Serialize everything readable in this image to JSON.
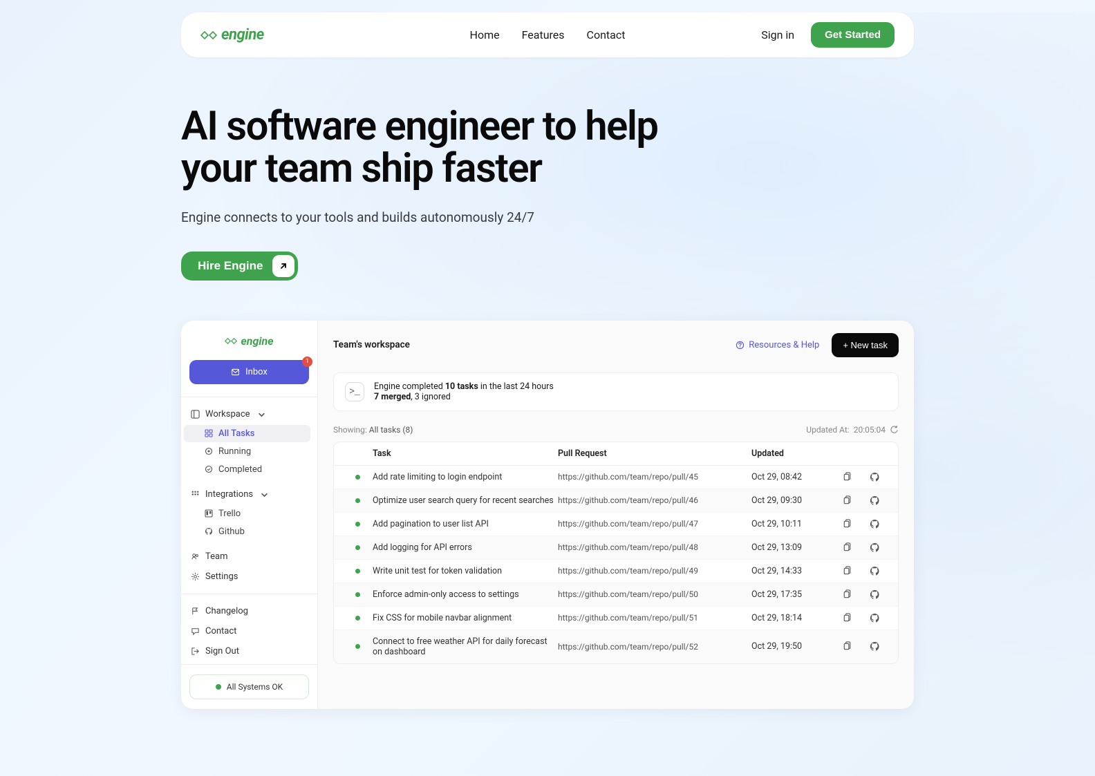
{
  "nav": {
    "brand": "engine",
    "links": [
      "Home",
      "Features",
      "Contact"
    ],
    "signin": "Sign in",
    "cta": "Get Started"
  },
  "hero": {
    "title_line1": "AI software engineer to help",
    "title_line2": "your team ship faster",
    "subtitle": "Engine connects to your tools and builds autonomously 24/7",
    "hire": "Hire Engine"
  },
  "app": {
    "sidebar": {
      "brand": "engine",
      "inbox": "Inbox",
      "inbox_badge": "1",
      "workspace_label": "Workspace",
      "workspace_items": [
        {
          "icon": "grid",
          "label": "All Tasks",
          "active": true
        },
        {
          "icon": "play",
          "label": "Running",
          "active": false
        },
        {
          "icon": "check",
          "label": "Completed",
          "active": false
        }
      ],
      "integrations_label": "Integrations",
      "integration_items": [
        {
          "icon": "trello",
          "label": "Trello"
        },
        {
          "icon": "github",
          "label": "Github"
        }
      ],
      "bottom_items": [
        {
          "icon": "users",
          "label": "Team"
        },
        {
          "icon": "gear",
          "label": "Settings"
        }
      ],
      "footer_items": [
        {
          "icon": "flag",
          "label": "Changelog"
        },
        {
          "icon": "chat",
          "label": "Contact"
        },
        {
          "icon": "logout",
          "label": "Sign Out"
        }
      ],
      "status": "All Systems OK"
    },
    "main": {
      "workspace_title": "Team's workspace",
      "resources": "Resources & Help",
      "new_task": "+ New task",
      "summary": {
        "prefix": "Engine completed ",
        "bold1": "10 tasks",
        "mid": " in the last 24 hours",
        "bold2": "7 merged",
        "suffix": ", 3 ignored"
      },
      "showing_label": "Showing: ",
      "showing_value": "All tasks (8)",
      "updated_label": "Updated At: ",
      "updated_value": "20:05:04",
      "columns": {
        "task": "Task",
        "pr": "Pull Request",
        "updated": "Updated"
      },
      "rows": [
        {
          "task": "Add rate limiting to login endpoint",
          "pr": "https://github.com/team/repo/pull/45",
          "updated": "Oct 29, 08:42"
        },
        {
          "task": "Optimize user search query for recent searches",
          "pr": "https://github.com/team/repo/pull/46",
          "updated": "Oct 29, 09:30"
        },
        {
          "task": "Add pagination to user list API",
          "pr": "https://github.com/team/repo/pull/47",
          "updated": "Oct 29, 10:11"
        },
        {
          "task": "Add logging for API errors",
          "pr": "https://github.com/team/repo/pull/48",
          "updated": "Oct 29, 13:09"
        },
        {
          "task": "Write unit test for token validation",
          "pr": "https://github.com/team/repo/pull/49",
          "updated": "Oct 29, 14:33"
        },
        {
          "task": "Enforce admin-only access to settings",
          "pr": "https://github.com/team/repo/pull/50",
          "updated": "Oct 29, 17:35"
        },
        {
          "task": "Fix CSS for mobile navbar alignment",
          "pr": "https://github.com/team/repo/pull/51",
          "updated": "Oct 29, 18:14"
        },
        {
          "task": "Connect to free weather API for daily forecast on dashboard",
          "pr": "https://github.com/team/repo/pull/52",
          "updated": "Oct 29, 19:50"
        }
      ]
    }
  }
}
